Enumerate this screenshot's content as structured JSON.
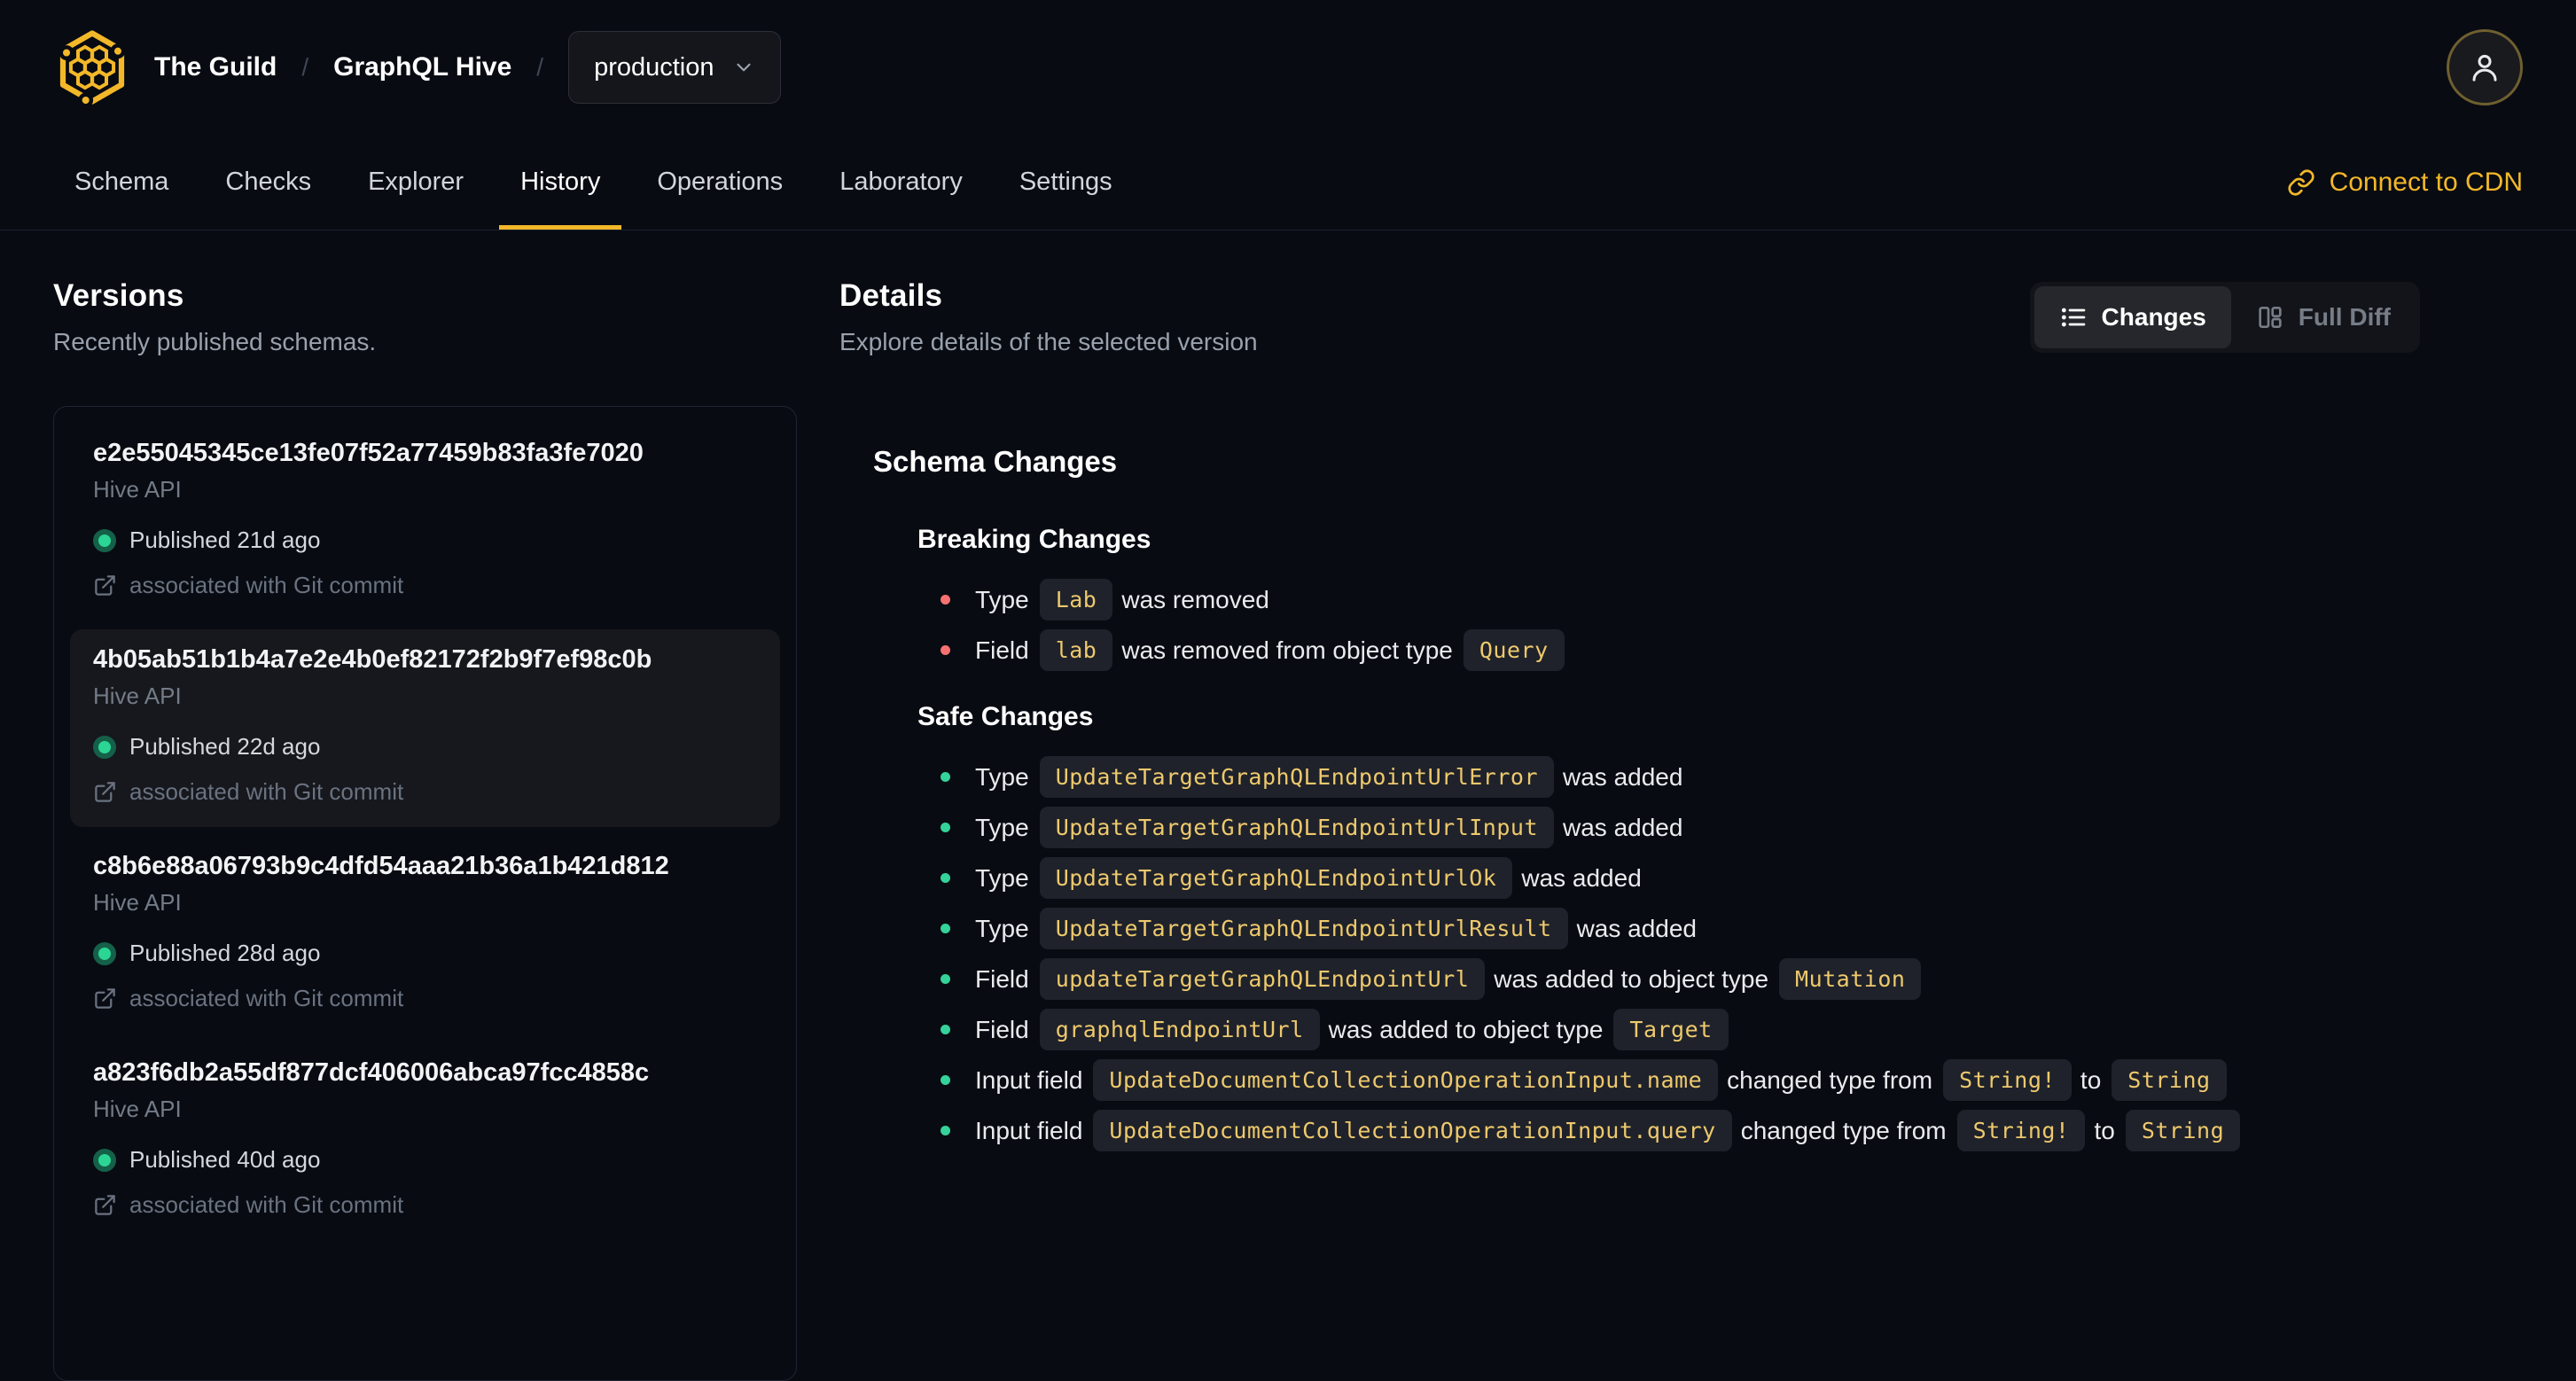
{
  "theme": {
    "bg": "#080b12",
    "accent": "#f3b829",
    "breaking": "#f87171",
    "safe": "#34d399",
    "published": "#2bd694"
  },
  "header": {
    "org": "The Guild",
    "separator": "/",
    "project": "GraphQL Hive",
    "target_selector": "production"
  },
  "nav": {
    "tabs": [
      {
        "label": "Schema"
      },
      {
        "label": "Checks"
      },
      {
        "label": "Explorer"
      },
      {
        "label": "History",
        "active": true
      },
      {
        "label": "Operations"
      },
      {
        "label": "Laboratory"
      },
      {
        "label": "Settings"
      }
    ],
    "connect_cdn": "Connect to CDN"
  },
  "versions": {
    "title": "Versions",
    "subtitle": "Recently published schemas.",
    "items": [
      {
        "hash": "e2e55045345ce13fe07f52a77459b83fa3fe7020",
        "service": "Hive API",
        "status": "Published 21d ago",
        "git": "associated with Git commit",
        "selected": false
      },
      {
        "hash": "4b05ab51b1b4a7e2e4b0ef82172f2b9f7ef98c0b",
        "service": "Hive API",
        "status": "Published 22d ago",
        "git": "associated with Git commit",
        "selected": true
      },
      {
        "hash": "c8b6e88a06793b9c4dfd54aaa21b36a1b421d812",
        "service": "Hive API",
        "status": "Published 28d ago",
        "git": "associated with Git commit",
        "selected": false
      },
      {
        "hash": "a823f6db2a55df877dcf406006abca97fcc4858c",
        "service": "Hive API",
        "status": "Published 40d ago",
        "git": "associated with Git commit",
        "selected": false
      }
    ]
  },
  "details": {
    "title": "Details",
    "subtitle": "Explore details of the selected version",
    "view_toggle": {
      "changes": "Changes",
      "full_diff": "Full Diff",
      "active": "changes"
    },
    "schema_changes_title": "Schema Changes",
    "sections": [
      {
        "title": "Breaking Changes",
        "severity": "breaking",
        "items": [
          [
            {
              "text": "Type"
            },
            {
              "code": "Lab"
            },
            {
              "text": "was removed"
            }
          ],
          [
            {
              "text": "Field"
            },
            {
              "code": "lab"
            },
            {
              "text": "was removed from object type"
            },
            {
              "code": "Query"
            }
          ]
        ]
      },
      {
        "title": "Safe Changes",
        "severity": "safe",
        "items": [
          [
            {
              "text": "Type"
            },
            {
              "code": "UpdateTargetGraphQLEndpointUrlError"
            },
            {
              "text": "was added"
            }
          ],
          [
            {
              "text": "Type"
            },
            {
              "code": "UpdateTargetGraphQLEndpointUrlInput"
            },
            {
              "text": "was added"
            }
          ],
          [
            {
              "text": "Type"
            },
            {
              "code": "UpdateTargetGraphQLEndpointUrlOk"
            },
            {
              "text": "was added"
            }
          ],
          [
            {
              "text": "Type"
            },
            {
              "code": "UpdateTargetGraphQLEndpointUrlResult"
            },
            {
              "text": "was added"
            }
          ],
          [
            {
              "text": "Field"
            },
            {
              "code": "updateTargetGraphQLEndpointUrl"
            },
            {
              "text": "was added to object type"
            },
            {
              "code": "Mutation"
            }
          ],
          [
            {
              "text": "Field"
            },
            {
              "code": "graphqlEndpointUrl"
            },
            {
              "text": "was added to object type"
            },
            {
              "code": "Target"
            }
          ],
          [
            {
              "text": "Input field"
            },
            {
              "code": "UpdateDocumentCollectionOperationInput.name"
            },
            {
              "text": "changed type from"
            },
            {
              "code": "String!"
            },
            {
              "text": "to"
            },
            {
              "code": "String"
            }
          ],
          [
            {
              "text": "Input field"
            },
            {
              "code": "UpdateDocumentCollectionOperationInput.query"
            },
            {
              "text": "changed type from"
            },
            {
              "code": "String!"
            },
            {
              "text": "to"
            },
            {
              "code": "String"
            }
          ]
        ]
      }
    ]
  }
}
